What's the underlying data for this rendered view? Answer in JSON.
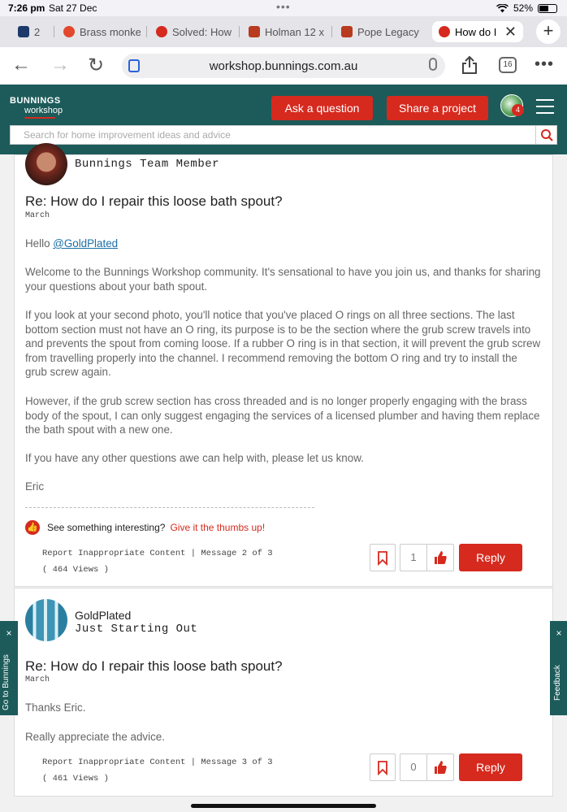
{
  "status": {
    "time": "7:26 pm",
    "date": "Sat 27 Dec",
    "battery": "52%"
  },
  "tabs": [
    {
      "label": "2",
      "fav_color": "#1e3a6b"
    },
    {
      "label": "Brass monke",
      "fav_color": "#e2482d"
    },
    {
      "label": "Solved: How",
      "fav_color": "#d62a1f"
    },
    {
      "label": "Holman 12 x",
      "fav_color": "#b83a1f"
    },
    {
      "label": "Pope Legacy",
      "fav_color": "#b83a1f"
    },
    {
      "label": "How do I",
      "fav_color": "#d62a1f",
      "active": true
    }
  ],
  "browser": {
    "url": "workshop.bunnings.com.au",
    "tab_count": "16"
  },
  "site": {
    "logo_main": "BUNNINGS",
    "logo_sub": "workshop",
    "ask_button": "Ask a question",
    "share_button": "Share a project",
    "notif_count": "4",
    "search_placeholder": "Search for home improvement ideas and advice",
    "accent_color": "#d62a1f",
    "header_color": "#1c5b5a"
  },
  "posts": [
    {
      "author_rank": "Bunnings Team Member",
      "title": "Re: How do I repair this loose bath spout?",
      "date": "March",
      "greeting": "Hello ",
      "mention": "@GoldPlated",
      "paragraphs": [
        "Welcome to the Bunnings Workshop community. It's sensational to have you join us, and thanks for sharing your questions about your bath spout.",
        "If you look at your second photo, you'll notice that you've placed O rings on all three sections. The last bottom section must not have an O ring, its purpose is to be the section where the grub screw travels into and prevents the spout from coming loose. If a rubber O ring is in that section, it will prevent the grub screw from travelling properly into the channel. I recommend removing the bottom O ring and try to install the grub screw again.",
        "However, if the grub screw section has cross threaded and is no longer properly engaging with the brass body of the spout, I can only suggest engaging the services of a licensed plumber and having them replace the bath spout with a new one.",
        "If you have any other questions awe can help with, please let us know.",
        "Eric"
      ],
      "thumbs_text": "See something interesting?",
      "thumbs_link": "Give it the thumbs up!",
      "report": "Report Inappropriate Content",
      "message_info": "Message 2 of 3",
      "views": "( 464 Views )",
      "likes": "1",
      "reply": "Reply"
    },
    {
      "author_name": "GoldPlated",
      "author_rank": "Just Starting Out",
      "title": "Re: How do I repair this loose bath spout?",
      "date": "March",
      "paragraphs": [
        "Thanks Eric.",
        "Really appreciate the advice."
      ],
      "report": "Report Inappropriate Content",
      "message_info": "Message 3 of 3",
      "views": "( 461 Views )",
      "likes": "0",
      "reply": "Reply"
    }
  ],
  "side": {
    "left_label": "Go to Bunnings",
    "right_label": "Feedback",
    "close": "×"
  }
}
